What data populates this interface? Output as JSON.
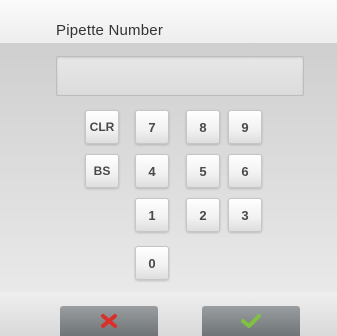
{
  "header": {
    "title": "Pipette Number"
  },
  "display": {
    "value": ""
  },
  "keypad": {
    "clr": "CLR",
    "bs": "BS",
    "k7": "7",
    "k8": "8",
    "k9": "9",
    "k4": "4",
    "k5": "5",
    "k6": "6",
    "k1": "1",
    "k2": "2",
    "k3": "3",
    "k0": "0"
  },
  "footer": {
    "cancel_icon": "close-icon",
    "confirm_icon": "check-icon",
    "cancel_color": "#d9302a",
    "confirm_color": "#7fc241"
  }
}
